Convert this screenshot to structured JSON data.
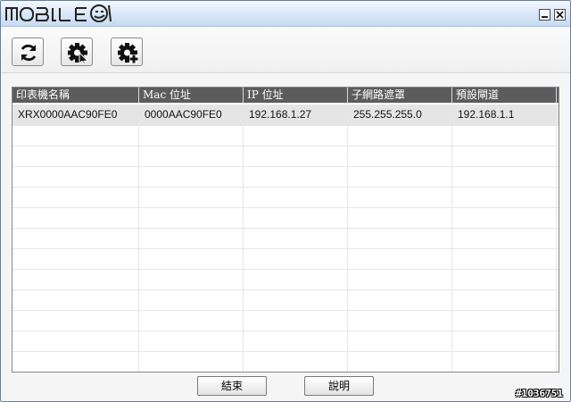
{
  "window": {
    "logo_text": "MOBILE01"
  },
  "toolbar": {
    "refresh_icon": "refresh-icon",
    "settings_cursor_icon": "gear-cursor-icon",
    "settings_add_icon": "gear-plus-icon"
  },
  "table": {
    "columns": [
      "印表機名稱",
      "Mac 位址",
      "IP 位址",
      "子網路遮罩",
      "預設閘道"
    ],
    "rows": [
      [
        "XRX0000AAC90FE0",
        "0000AAC90FE0",
        "192.168.1.27",
        "255.255.255.0",
        "192.168.1.1"
      ]
    ],
    "empty_rows": 12
  },
  "footer": {
    "end_label": "結束",
    "help_label": "說明"
  },
  "watermark": "#1036751"
}
